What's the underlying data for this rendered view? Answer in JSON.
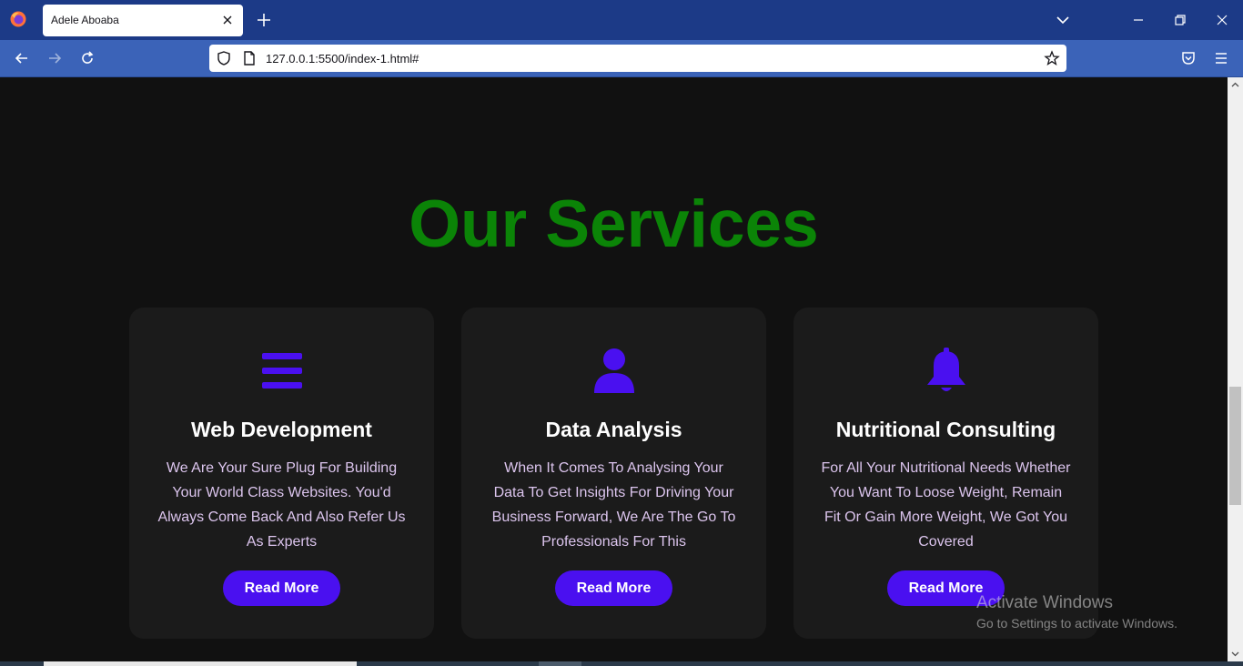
{
  "browser": {
    "tab_title": "Adele Aboaba",
    "url": "127.0.0.1:5500/index-1.html#"
  },
  "page": {
    "heading": "Our Services",
    "services": [
      {
        "icon": "bars-icon",
        "title": "Web Development",
        "description": "We Are Your Sure Plug For Building Your World Class Websites. You'd Always Come Back And Also Refer Us As Experts",
        "button": "Read More"
      },
      {
        "icon": "user-icon",
        "title": "Data Analysis",
        "description": "When It Comes To Analysing Your Data To Get Insights For Driving Your Business Forward, We Are The Go To Professionals For This",
        "button": "Read More"
      },
      {
        "icon": "bell-icon",
        "title": "Nutritional Consulting",
        "description": "For All Your Nutritional Needs Whether You Want To Loose Weight, Remain Fit Or Gain More Weight, We Got You Covered",
        "button": "Read More"
      }
    ]
  },
  "watermark": {
    "title": "Activate Windows",
    "subtitle": "Go to Settings to activate Windows."
  },
  "colors": {
    "heading": "#0b8407",
    "accent": "#4a10f0",
    "card_bg": "#1b1b1b",
    "page_bg": "#111111",
    "description": "#dcc5ee",
    "chrome_tabbar": "#1c3a87",
    "chrome_navbar": "#3b63b8"
  }
}
